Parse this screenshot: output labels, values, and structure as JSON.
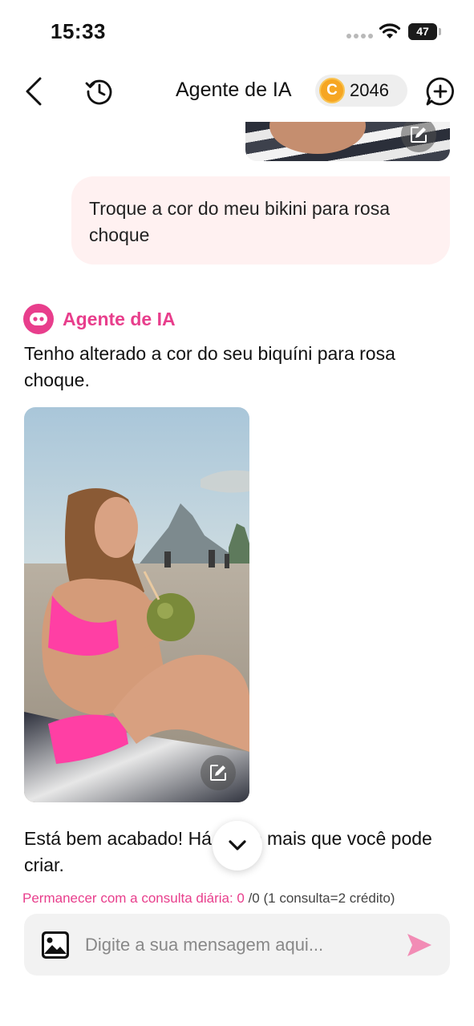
{
  "status_bar": {
    "time": "15:33",
    "battery": "47",
    "battery_level": 0.47
  },
  "nav": {
    "title": "Agente de IA",
    "coin_symbol": "C",
    "coins": "2046",
    "icons": {
      "back": "chevron-left-icon",
      "history": "history-icon",
      "new_chat": "chat-plus-icon"
    }
  },
  "messages": {
    "user_message": "Troque a cor do meu bikini para rosa choque",
    "agent_name": "Agente de IA",
    "agent_reply": "Tenho alterado a cor do seu biquíni para rosa choque.",
    "agent_followup": "Está bem acabado! Há muito mais que você pode criar."
  },
  "quota": {
    "label": "Permanecer com a consulta diária: 0",
    "rest": " /0 (1 consulta=2 crédito)"
  },
  "composer": {
    "placeholder": "Digite a sua mensagem aqui...",
    "value": ""
  },
  "colors": {
    "accent": "#e83e8c",
    "bubble": "#fff1f1",
    "send": "#f28cb5",
    "coin": "#f6a623"
  }
}
